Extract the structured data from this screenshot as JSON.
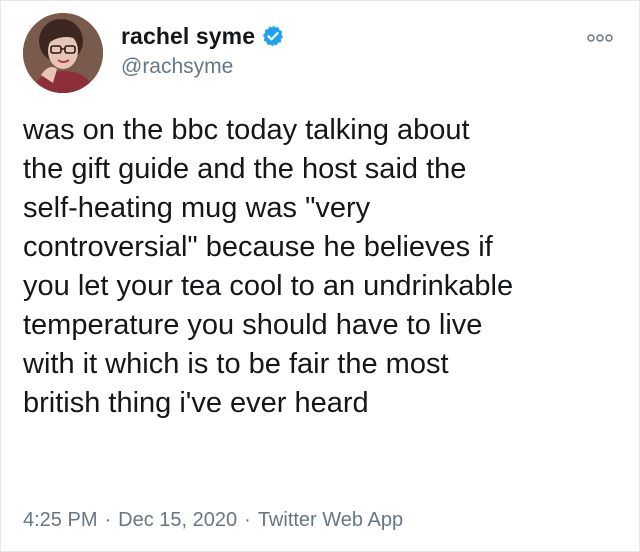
{
  "author": {
    "display_name": "rachel syme",
    "handle": "@rachsyme",
    "verified": true,
    "avatar_icon": "profile-photo",
    "verified_icon": "verified-badge-icon",
    "verified_color": "#1da1f2"
  },
  "menu": {
    "icon": "more-options-icon"
  },
  "tweet": {
    "text": "was on the bbc today talking about\nthe gift guide and the host said the\nself-heating mug was \"very\ncontroversial\" because he believes if\nyou let your tea cool to an undrinkable\ntemperature you should have to live\nwith it which is to be fair the most\nbritish thing i've ever heard"
  },
  "meta": {
    "time": "4:25 PM",
    "separator_1": "·",
    "date": "Dec 15, 2020",
    "separator_2": "·",
    "source": "Twitter Web App"
  },
  "colors": {
    "text": "#14171a",
    "secondary": "#657786"
  }
}
